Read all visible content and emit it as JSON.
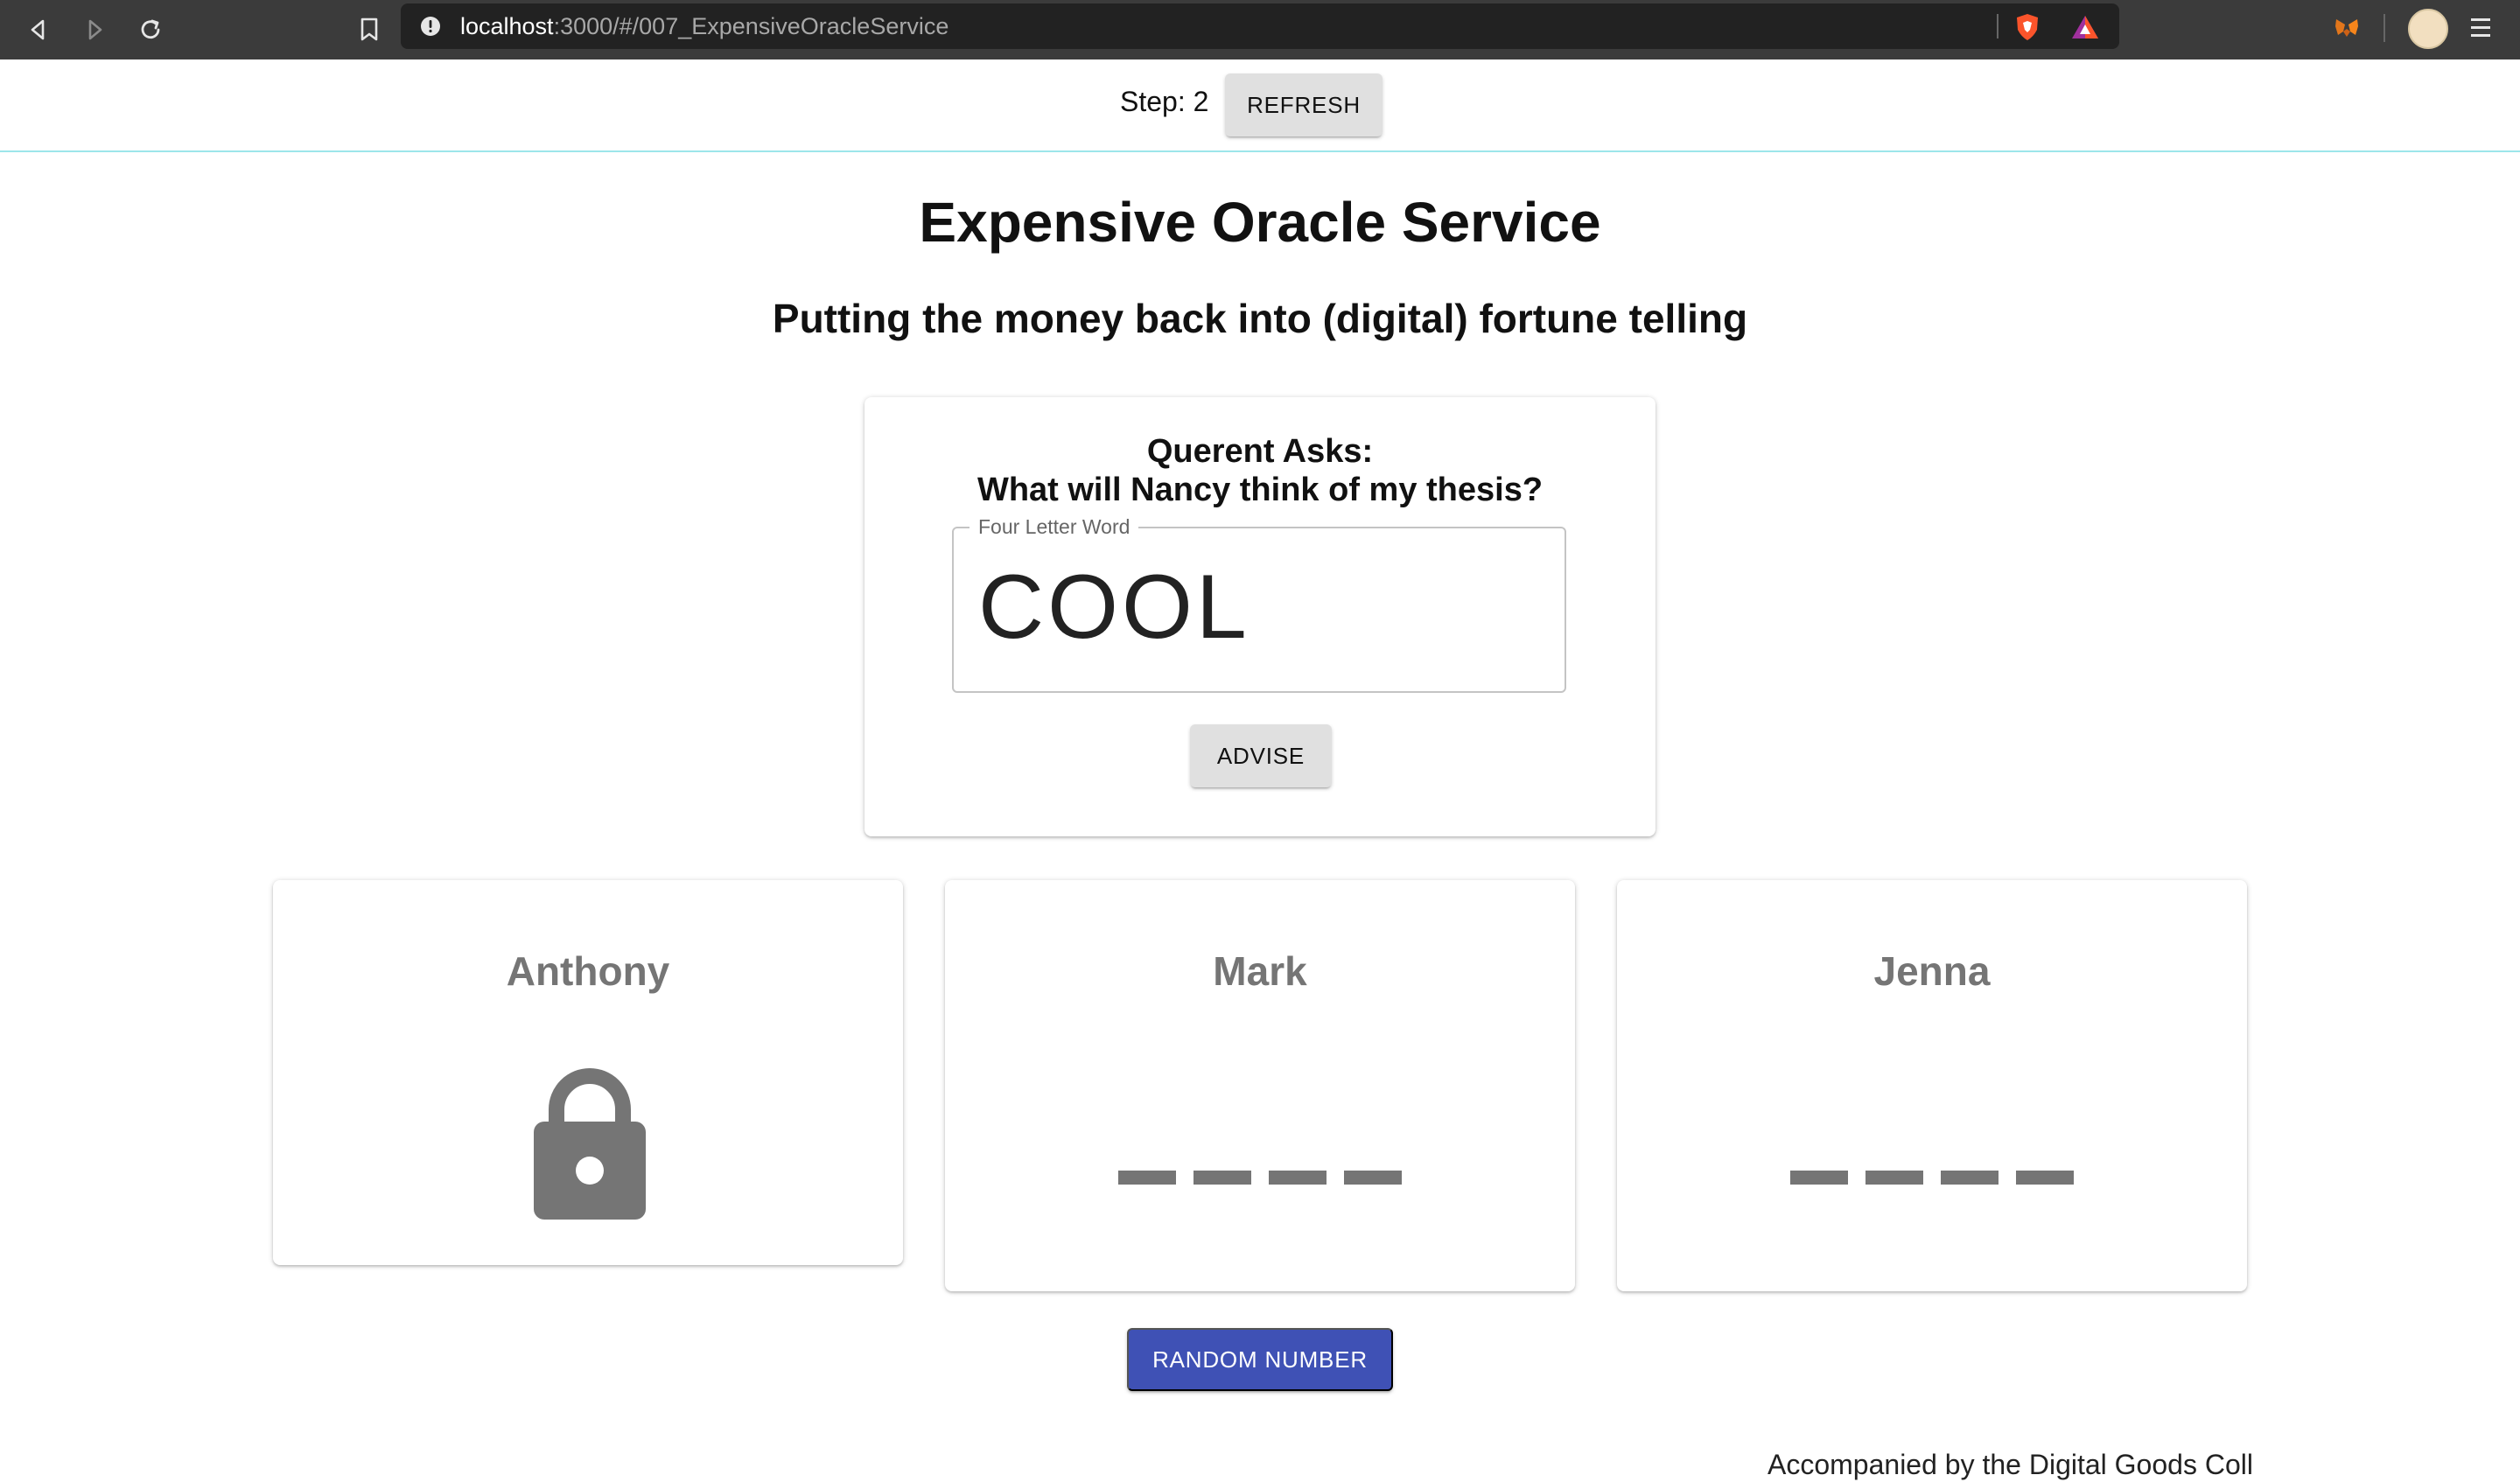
{
  "browser": {
    "url_host": "localhost",
    "url_path": ":3000/#/007_ExpensiveOracleService",
    "icons": [
      "back-icon",
      "forward-icon",
      "reload-icon",
      "bookmark-icon",
      "info-icon",
      "brave-shield-icon",
      "brave-rewards-icon",
      "metamask-icon",
      "profile-avatar",
      "menu-icon"
    ]
  },
  "header": {
    "step_label": "Step: 2",
    "refresh_label": "REFRESH"
  },
  "page": {
    "title": "Expensive Oracle Service",
    "subtitle": "Putting the money back into (digital) fortune telling"
  },
  "oracle": {
    "question_heading": "Querent Asks:",
    "question": "What will Nancy think of my thesis?",
    "field_label": "Four Letter Word",
    "field_value": "COOL",
    "advise_label": "ADVISE"
  },
  "participants": [
    {
      "name": "Anthony",
      "state": "locked",
      "icon": "lock-icon"
    },
    {
      "name": "Mark",
      "state": "pending",
      "icon": "dashes"
    },
    {
      "name": "Jenna",
      "state": "pending",
      "icon": "dashes"
    }
  ],
  "random_label": "RANDOM NUMBER",
  "footer_text": "Accompanied by the Digital Goods Coll",
  "colors": {
    "accent": "#3f51b5",
    "divider": "#9de6ea",
    "muted": "#757575",
    "button_grey": "#e0e0e0"
  }
}
